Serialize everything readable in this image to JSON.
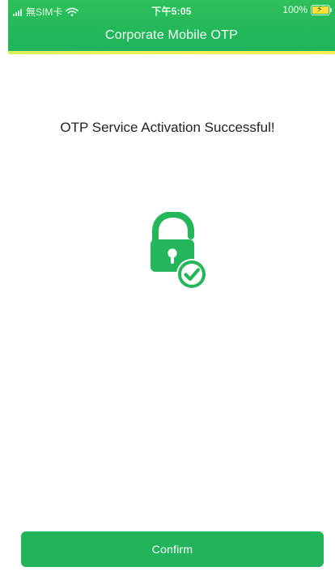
{
  "status_bar": {
    "carrier": "無SIM卡",
    "time": "下午5:05",
    "battery_percent": "100%",
    "battery_level": 1.0,
    "battery_charging": true,
    "wifi_icon": "wifi-icon",
    "battery_icon": "battery-icon"
  },
  "nav": {
    "title": "Corporate Mobile OTP"
  },
  "main": {
    "headline": "OTP Service Activation Successful!",
    "illustration": "padlock-unlocked-check-icon"
  },
  "actions": {
    "confirm_label": "Confirm"
  },
  "colors": {
    "brand_green": "#21b45a",
    "header_accent_yellow": "#eaf35d"
  }
}
